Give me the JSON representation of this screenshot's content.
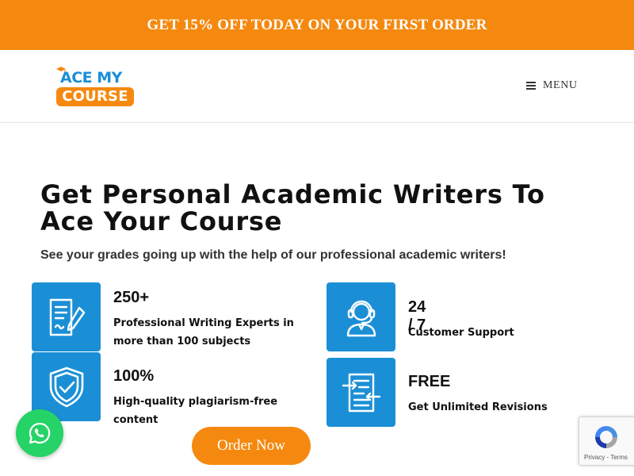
{
  "promo": {
    "text": "GET 15% OFF TODAY ON YOUR FIRST ORDER"
  },
  "header": {
    "logo": {
      "line1": "ACE MY",
      "line2": "COURSE"
    },
    "menu_label": "MENU"
  },
  "hero": {
    "title": "Get Personal Academic Writers To Ace Your Course",
    "subtitle": "See your grades going up with the help of our professional academic writers!"
  },
  "features": [
    {
      "icon": "document-pen-icon",
      "title": "250+",
      "desc": "Professional Writing Experts in more than 100 subjects"
    },
    {
      "icon": "support-agent-icon",
      "title": "24 / 7",
      "desc": "Customer Support"
    },
    {
      "icon": "shield-check-icon",
      "title": "100%",
      "desc": "High-quality plagiarism-free content"
    },
    {
      "icon": "revision-document-icon",
      "title": "FREE",
      "desc": "Get Unlimited Revisions"
    }
  ],
  "cta": {
    "order_label": "Order Now"
  },
  "recaptcha": {
    "privacy": "Privacy",
    "separator": "-",
    "terms": "Terms"
  },
  "colors": {
    "accent_orange": "#f5890f",
    "icon_blue": "#1b8fd6",
    "whatsapp_green": "#25d366"
  }
}
